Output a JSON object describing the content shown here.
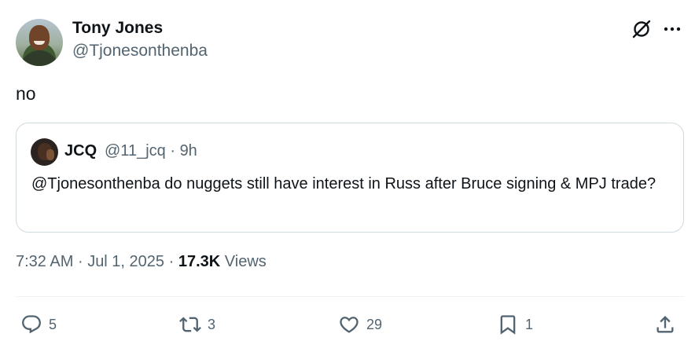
{
  "author": {
    "name": "Tony Jones",
    "handle": "@Tjonesonthenba"
  },
  "tweet": {
    "text": "no"
  },
  "quote": {
    "name": "JCQ",
    "handle": "@11_jcq",
    "separator": "·",
    "time": "9h",
    "text": "@Tjonesonthenba do nuggets still have interest in Russ after Bruce signing & MPJ trade?"
  },
  "meta": {
    "time": "7:32 AM",
    "date": "Jul 1, 2025",
    "separator": "·",
    "views_count": "17.3K",
    "views_label": "Views"
  },
  "actions": {
    "replies": "5",
    "reposts": "3",
    "likes": "29",
    "bookmarks": "1"
  },
  "icons": [
    "grok-icon",
    "more-icon",
    "reply-icon",
    "repost-icon",
    "like-icon",
    "bookmark-icon",
    "share-icon"
  ],
  "colors": {
    "text": "#0f1419",
    "secondary": "#536471",
    "border": "#cfd9de"
  }
}
